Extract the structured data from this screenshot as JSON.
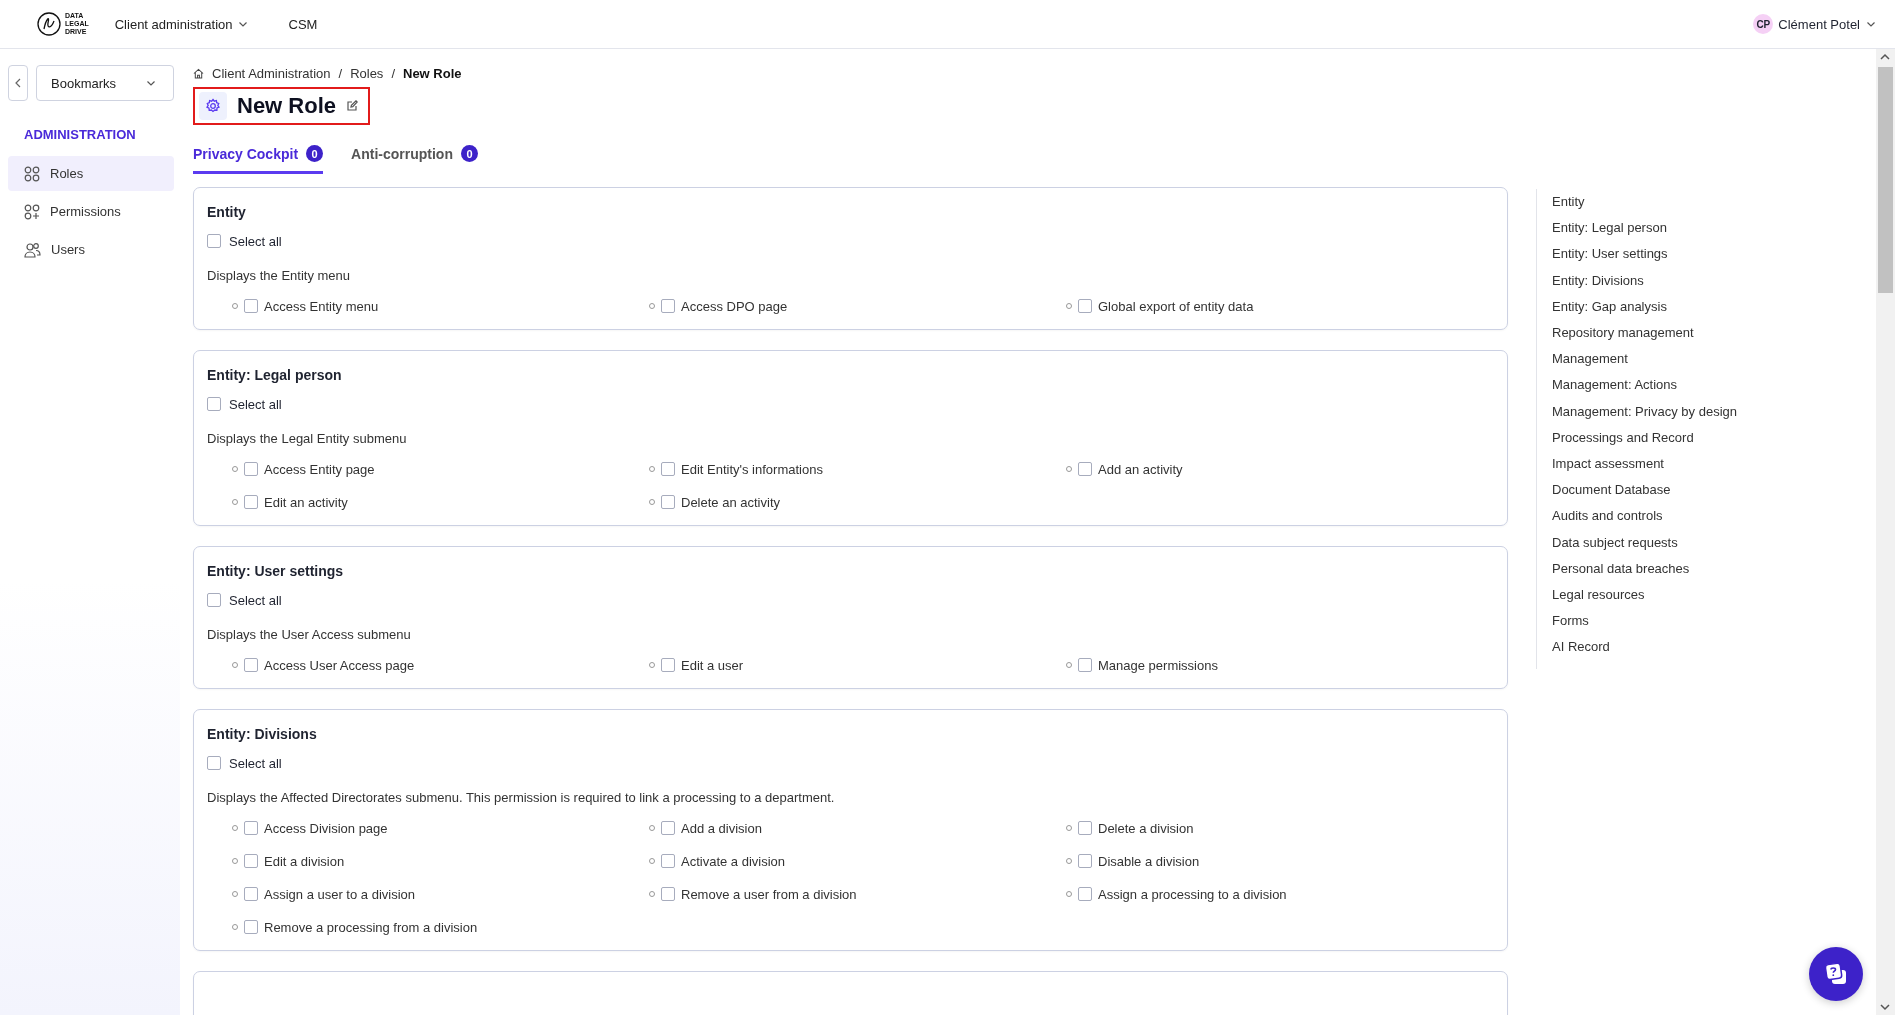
{
  "header": {
    "logo_lines": [
      "DATA",
      "LEGAL",
      "DRIVE"
    ],
    "nav": [
      {
        "label": "Client administration",
        "dropdown": true
      },
      {
        "label": "CSM",
        "dropdown": false
      }
    ],
    "user": {
      "initials": "CP",
      "name": "Clément Potel"
    }
  },
  "sidebar": {
    "bookmarks": "Bookmarks",
    "section": "ADMINISTRATION",
    "items": [
      {
        "label": "Roles",
        "selected": true
      },
      {
        "label": "Permissions",
        "selected": false
      },
      {
        "label": "Users",
        "selected": false
      }
    ]
  },
  "breadcrumb": {
    "separator": "/",
    "items": [
      "Client Administration",
      "Roles",
      "New Role"
    ]
  },
  "title": {
    "text": "New Role",
    "highlighted": true
  },
  "tabs": [
    {
      "label": "Privacy Cockpit",
      "count": "0",
      "selected": true
    },
    {
      "label": "Anti-corruption",
      "count": "0",
      "selected": false
    }
  ],
  "sections": [
    {
      "title": "Entity",
      "select_all": {
        "label": "Select all",
        "checked": false
      },
      "description": "Displays the Entity menu",
      "items": [
        {
          "label": "Access Entity menu",
          "checked": false
        },
        {
          "label": "Access DPO page",
          "checked": false
        },
        {
          "label": "Global export of entity data",
          "checked": false
        }
      ]
    },
    {
      "title": "Entity: Legal person",
      "select_all": {
        "label": "Select all",
        "checked": false
      },
      "description": "Displays the Legal Entity submenu",
      "items": [
        {
          "label": "Access Entity page",
          "checked": false
        },
        {
          "label": "Edit Entity's informations",
          "checked": false
        },
        {
          "label": "Add an activity",
          "checked": false
        },
        {
          "label": "Edit an activity",
          "checked": false
        },
        {
          "label": "Delete an activity",
          "checked": false
        }
      ]
    },
    {
      "title": "Entity: User settings",
      "select_all": {
        "label": "Select all",
        "checked": false
      },
      "description": "Displays the User Access submenu",
      "items": [
        {
          "label": "Access User Access page",
          "checked": false
        },
        {
          "label": "Edit a user",
          "checked": false
        },
        {
          "label": "Manage permissions",
          "checked": false
        }
      ]
    },
    {
      "title": "Entity: Divisions",
      "select_all": {
        "label": "Select all",
        "checked": false
      },
      "description": "Displays the Affected Directorates submenu. This permission is required to link a processing to a department.",
      "items": [
        {
          "label": "Access Division page",
          "checked": false
        },
        {
          "label": "Add a division",
          "checked": false
        },
        {
          "label": "Delete a division",
          "checked": false
        },
        {
          "label": "Edit a division",
          "checked": false
        },
        {
          "label": "Activate a division",
          "checked": false
        },
        {
          "label": "Disable a division",
          "checked": false
        },
        {
          "label": "Assign a user to a division",
          "checked": false
        },
        {
          "label": "Remove a user from a division",
          "checked": false
        },
        {
          "label": "Assign a processing to a division",
          "checked": false
        },
        {
          "label": "Remove a processing from a division",
          "checked": false
        }
      ]
    }
  ],
  "outline": [
    "Entity",
    "Entity: Legal person",
    "Entity: User settings",
    "Entity: Divisions",
    "Entity: Gap analysis",
    "Repository management",
    "Management",
    "Management: Actions",
    "Management: Privacy by design",
    "Processings and Record",
    "Impact assessment",
    "Document Database",
    "Audits and controls",
    "Data subject requests",
    "Personal data breaches",
    "Legal resources",
    "Forms",
    "AI Record"
  ]
}
